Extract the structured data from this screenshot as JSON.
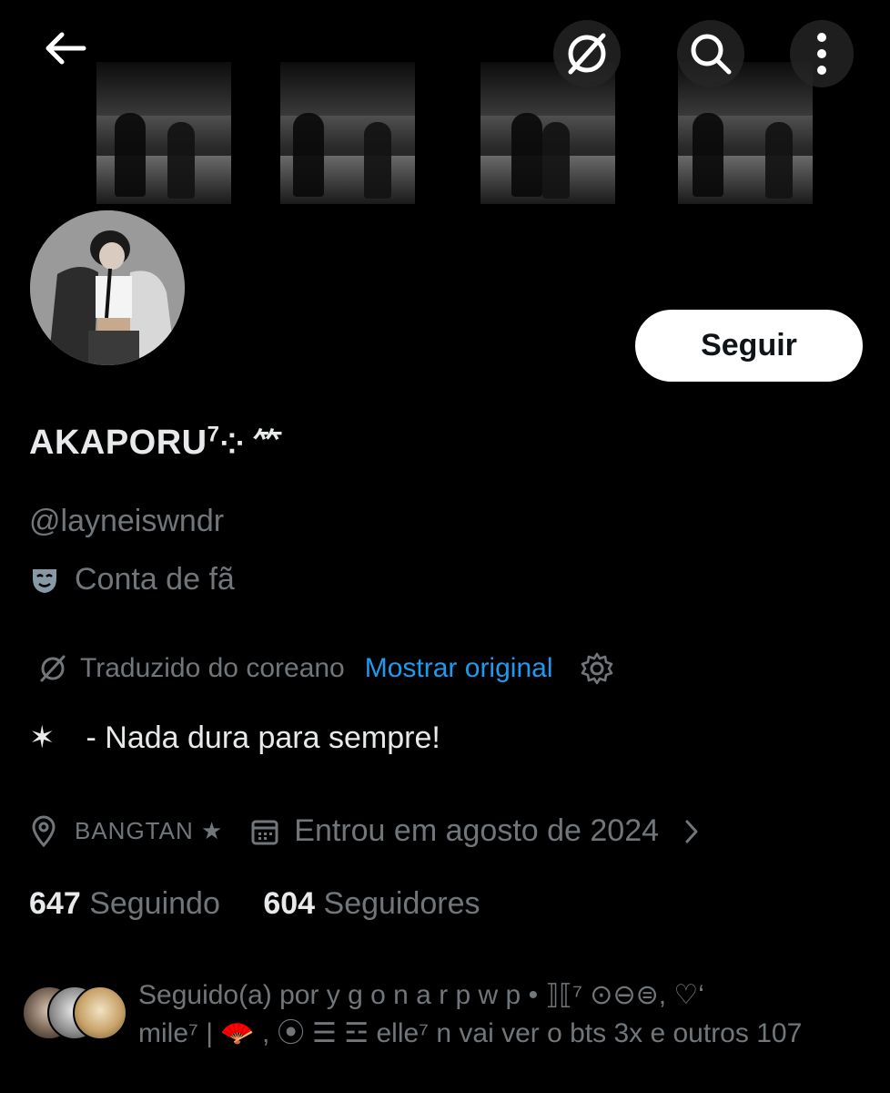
{
  "header": {
    "back_icon": "arrow-left-icon",
    "translate_icon": "translate-slash-icon",
    "search_icon": "search-icon",
    "more_icon": "more-vertical-icon"
  },
  "banner": {
    "description": "four black-and-white film frames"
  },
  "profile": {
    "display_name": "AKAPORU",
    "display_name_sup": "7",
    "display_name_suffix": "⁘ ⺮",
    "handle": "@layneiswndr",
    "category": "Conta de fã",
    "follow_button": "Seguir"
  },
  "translation": {
    "label": "Traduzido do coreano",
    "show_original": "Mostrar original"
  },
  "bio": {
    "star": "✶",
    "text": "- Nada dura para sempre!"
  },
  "meta": {
    "location": "BANGTAN ★",
    "joined": "Entrou em agosto de 2024"
  },
  "stats": {
    "following_count": "647",
    "following_label": "Seguindo",
    "followers_count": "604",
    "followers_label": "Seguidores"
  },
  "followed_by": {
    "line1": "Seguido(a) por  y  g  o  n  a  r  p w p • ⟧⟦⁷ ⊙⊖⊜, ♡‘",
    "line2": "mile⁷ | 🪭 , ⦿ ☰ ☲ elle⁷ n vai ver o bts 3x e outros 107"
  },
  "colors": {
    "background": "#000000",
    "text_primary": "#e7e9ea",
    "text_secondary": "#71767b",
    "link": "#1d9bf0",
    "button_bg": "#ffffff",
    "button_text": "#0f1419"
  }
}
